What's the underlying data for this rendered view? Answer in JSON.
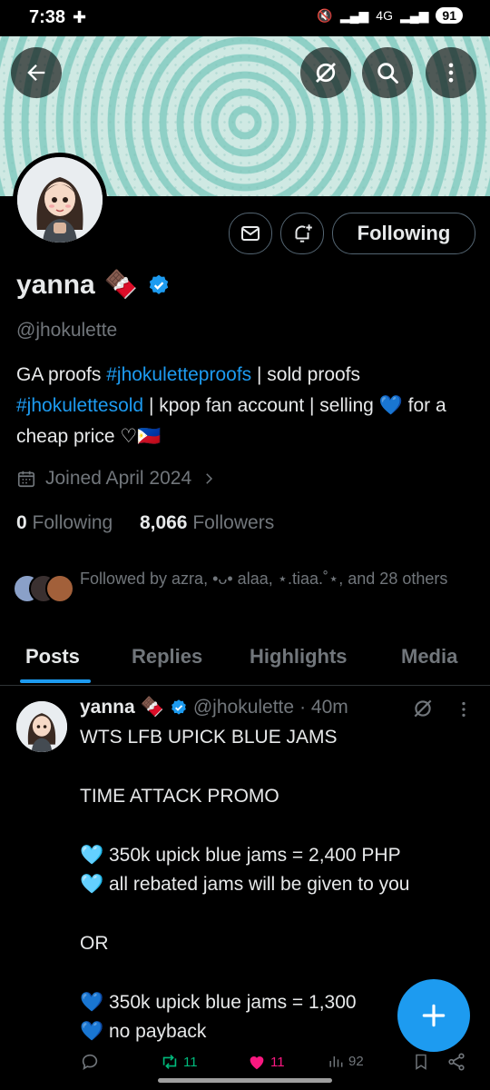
{
  "status_bar": {
    "time": "7:38",
    "battery": "91",
    "network": "4G"
  },
  "profile": {
    "name": "yanna",
    "name_emoji": "🍫",
    "handle": "@jhokulette",
    "bio": {
      "part1": "GA proofs ",
      "link1": "#jhokuletteproofs",
      "part2": " | sold proofs ",
      "link2": "#jhokulettesold",
      "part3": " | kpop fan account | selling ",
      "part4": "💙 for a cheap price ♡🇵🇭"
    },
    "joined": "Joined April 2024",
    "following_count": "0",
    "following_label": "Following",
    "followers_count": "8,066",
    "followers_label": "Followers",
    "followed_by": "Followed by azra, •ᴗ• alaa, ⋆.tiaa.˚⋆, and 28 others",
    "follow_button": "Following"
  },
  "tabs": [
    "Posts",
    "Replies",
    "Highlights",
    "Media"
  ],
  "post": {
    "name": "yanna",
    "name_emoji": "🍫",
    "handle": "@jhokulette",
    "time": "· 40m",
    "body": "WTS LFB UPICK BLUE JAMS\n\nTIME ATTACK PROMO\n\n🩵 350k upick blue jams = 2,400 PHP\n🩵 all rebated jams will be given to you\n\nOR\n\n💙 350k upick blue jams = 1,300\n💙 no payback",
    "retweets": "11",
    "likes": "11",
    "views": "92"
  },
  "colors": {
    "accent": "#1d9bf0",
    "like": "#f91880",
    "retweet": "#00ba7c",
    "muted": "#71767b"
  }
}
